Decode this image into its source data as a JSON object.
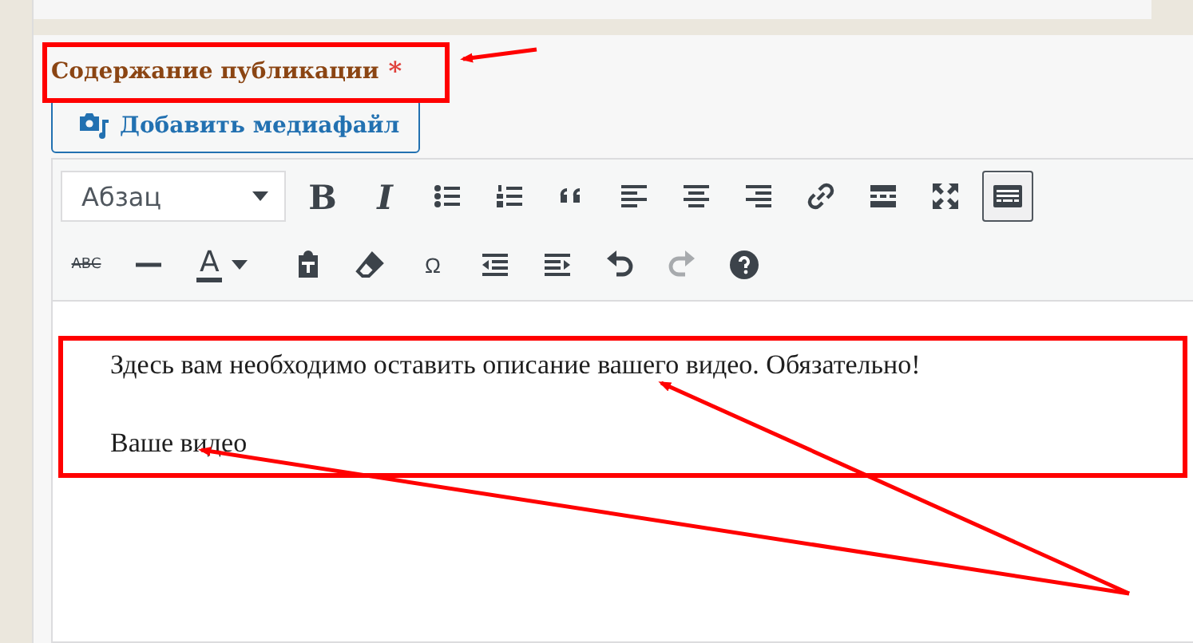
{
  "field": {
    "label": "Содержание публикации",
    "required_mark": "*"
  },
  "media_button": {
    "label": "Добавить медиафайл"
  },
  "toolbar": {
    "format_select": {
      "value": "Абзац"
    },
    "rows": [
      [
        {
          "kind": "glyph",
          "label": "B",
          "selected": false,
          "disabled": false
        },
        {
          "kind": "glyph",
          "label": "I",
          "selected": false,
          "disabled": false
        },
        {
          "kind": "icon",
          "selected": false,
          "disabled": false
        },
        {
          "kind": "icon",
          "selected": false,
          "disabled": false
        },
        {
          "kind": "icon",
          "selected": false,
          "disabled": false
        },
        {
          "kind": "icon",
          "selected": false,
          "disabled": false
        },
        {
          "kind": "icon",
          "selected": false,
          "disabled": false
        },
        {
          "kind": "icon",
          "selected": false,
          "disabled": false
        },
        {
          "kind": "icon",
          "selected": false,
          "disabled": false
        },
        {
          "kind": "icon",
          "selected": false,
          "disabled": false
        },
        {
          "kind": "icon",
          "selected": false,
          "disabled": false
        },
        {
          "kind": "icon",
          "selected": true,
          "disabled": false
        }
      ],
      [
        {
          "kind": "glyph",
          "label": "ABC",
          "selected": false,
          "disabled": false
        },
        {
          "kind": "icon",
          "selected": false,
          "disabled": false
        },
        {
          "kind": "color",
          "label": "A",
          "selected": false,
          "disabled": false
        },
        {
          "kind": "icon",
          "selected": false,
          "disabled": false
        },
        {
          "kind": "icon",
          "selected": false,
          "disabled": false
        },
        {
          "kind": "glyph",
          "label": "Ω",
          "selected": false,
          "disabled": false
        },
        {
          "kind": "icon",
          "selected": false,
          "disabled": false
        },
        {
          "kind": "icon",
          "selected": false,
          "disabled": false
        },
        {
          "kind": "icon",
          "selected": false,
          "disabled": false
        },
        {
          "kind": "icon",
          "selected": false,
          "disabled": true
        },
        {
          "kind": "icon",
          "selected": false,
          "disabled": false
        }
      ]
    ]
  },
  "content": {
    "paragraphs": [
      "Здесь вам необходимо оставить описание вашего видео. Обязательно!",
      "Ваше видео"
    ]
  }
}
